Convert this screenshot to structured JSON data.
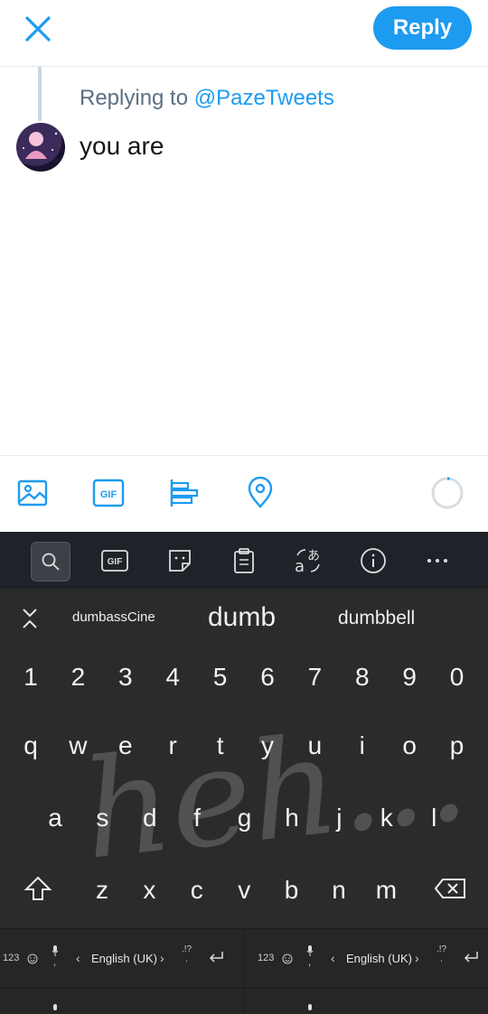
{
  "header": {
    "reply_label": "Reply"
  },
  "reply_context": {
    "prefix": "Replying to",
    "handle": "@PazeTweets"
  },
  "compose": {
    "text": "you are"
  },
  "toolbar": {
    "icons": [
      "image-icon",
      "gif-icon",
      "poll-icon",
      "location-icon"
    ]
  },
  "keyboard": {
    "top_icons": [
      "search-icon",
      "gif-icon",
      "sticker-icon",
      "clipboard-icon",
      "translate-icon",
      "info-icon",
      "more-icon"
    ],
    "gif_label": "GIF",
    "suggestions": [
      "dumbassCine",
      "dumb",
      "dumbbell"
    ],
    "number_row": [
      "1",
      "2",
      "3",
      "4",
      "5",
      "6",
      "7",
      "8",
      "9",
      "0"
    ],
    "row1": [
      "q",
      "w",
      "e",
      "r",
      "t",
      "y",
      "u",
      "i",
      "o",
      "p"
    ],
    "row2": [
      "a",
      "s",
      "d",
      "f",
      "g",
      "h",
      "j",
      "k",
      "l"
    ],
    "row3": [
      "z",
      "x",
      "c",
      "v",
      "b",
      "n",
      "m"
    ],
    "bottom_bar": {
      "numbers_label": "123",
      "punct_label": ".!?",
      "language": "English (UK)",
      "comma": ",",
      "period": "."
    },
    "watermark_text": "heh..."
  },
  "colors": {
    "accent": "#1d9bf0",
    "keyboard_bg": "#2b2b2b"
  }
}
